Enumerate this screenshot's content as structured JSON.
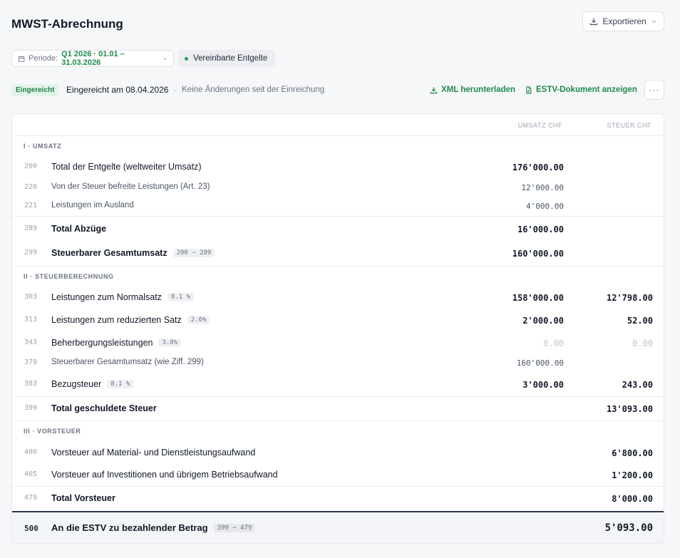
{
  "header": {
    "title": "MWST-Abrechnung",
    "export_label": "Exportieren"
  },
  "period": {
    "label": "Periode:",
    "value": "Q1 2026 · 01.01 – 31.03.2026"
  },
  "method_badge": "Vereinbarte Entgelte",
  "status": {
    "badge": "Eingereicht",
    "submitted": "Eingereicht am 08.04.2026",
    "separator": "·",
    "note": "Keine Änderungen seit der Einreichung",
    "xml_link": "XML herunterladen",
    "estv_link": "ESTV-Dokument anzeigen",
    "more": "···"
  },
  "table": {
    "col_umsatz": "Umsatz CHF",
    "col_steuer": "Steuer CHF",
    "sections": {
      "s1": "I · Umsatz",
      "s2": "II · Steuerberechnung",
      "s3": "III · Vorsteuer"
    },
    "rows": {
      "r200": {
        "code": "200",
        "label": "Total der Entgelte (weltweiter Umsatz)",
        "umsatz": "176'000.00"
      },
      "r220": {
        "code": "220",
        "label": "Von der Steuer befreite Leistungen (Art. 23)",
        "umsatz": "12'000.00"
      },
      "r221": {
        "code": "221",
        "label": "Leistungen im Ausland",
        "umsatz": "4'000.00"
      },
      "r289": {
        "code": "289",
        "label": "Total Abzüge",
        "umsatz": "16'000.00"
      },
      "r299": {
        "code": "299",
        "label": "Steuerbarer Gesamtumsatz",
        "chip": "200 − 289",
        "umsatz": "160'000.00"
      },
      "r303": {
        "code": "303",
        "label": "Leistungen zum Normalsatz",
        "chip": "8.1 %",
        "umsatz": "158'000.00",
        "steuer": "12'798.00"
      },
      "r313": {
        "code": "313",
        "label": "Leistungen zum reduzierten Satz",
        "chip": "2.6%",
        "umsatz": "2'000.00",
        "steuer": "52.00"
      },
      "r343": {
        "code": "343",
        "label": "Beherbergungsleistungen",
        "chip": "3.8%",
        "umsatz": "0.00",
        "steuer": "0.00"
      },
      "r379": {
        "code": "379",
        "label": "Steuerbarer Gesamtumsatz (wie Ziff. 299)",
        "umsatz": "160'000.00"
      },
      "r383": {
        "code": "383",
        "label": "Bezugsteuer",
        "chip": "8.1 %",
        "umsatz": "3'000.00",
        "steuer": "243.00"
      },
      "r399": {
        "code": "399",
        "label": "Total geschuldete Steuer",
        "steuer": "13'093.00"
      },
      "r400": {
        "code": "400",
        "label": "Vorsteuer auf Material- und Dienstleistungsaufwand",
        "steuer": "6'800.00"
      },
      "r405": {
        "code": "405",
        "label": "Vorsteuer auf Investitionen und übrigem Betriebsaufwand",
        "steuer": "1'200.00"
      },
      "r479": {
        "code": "479",
        "label": "Total Vorsteuer",
        "steuer": "8'000.00"
      }
    },
    "total": {
      "code": "500",
      "label": "An die ESTV zu bezahlender Betrag",
      "chip": "399 − 479",
      "steuer": "5'093.00"
    }
  },
  "colors": {
    "accent_green": "#1e8a4a",
    "text_dark": "#111827",
    "muted": "#9ca3af"
  }
}
